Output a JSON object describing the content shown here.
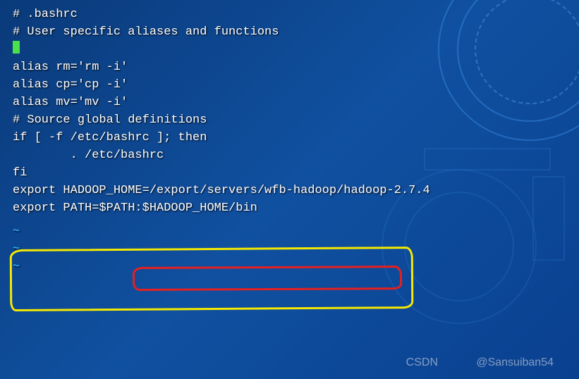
{
  "file": {
    "lines": [
      "# .bashrc",
      "",
      "# User specific aliases and functions",
      "",
      "alias rm='rm -i'",
      "alias cp='cp -i'",
      "alias mv='mv -i'",
      "",
      "# Source global definitions",
      "if [ -f /etc/bashrc ]; then",
      "        . /etc/bashrc",
      "fi",
      "",
      "export HADOOP_HOME=/export/servers/wfb-hadoop/hadoop-2.7.4",
      "export PATH=$PATH:$HADOOP_HOME/bin"
    ],
    "cursor_line_index": 3,
    "tildes": [
      "~",
      "~",
      "~"
    ]
  },
  "highlight": {
    "red_target_text": "/export/servers/wfb-hadoop/hadoop-2.7.4",
    "yellow_target_lines": [
      13,
      14
    ]
  },
  "watermark": {
    "site": "CSDN",
    "author": "@Sansuiban54"
  }
}
